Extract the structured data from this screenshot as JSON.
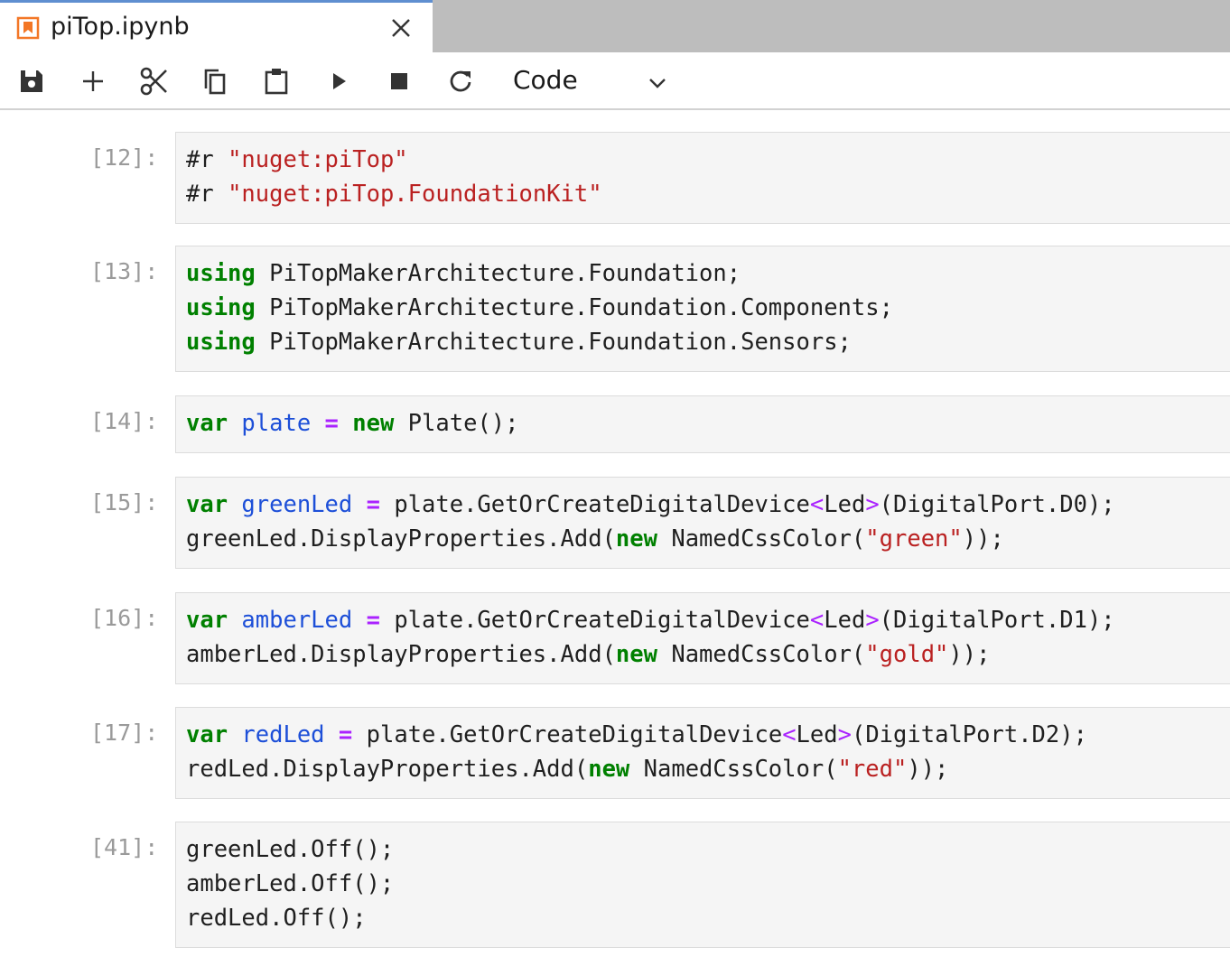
{
  "tab": {
    "title": "piTop.ipynb",
    "icon": "notebook-icon",
    "accent": "#f37726"
  },
  "toolbar": {
    "buttons": [
      "save-icon",
      "add-cell-icon",
      "cut-icon",
      "copy-icon",
      "paste-icon",
      "run-icon",
      "stop-icon",
      "restart-icon"
    ],
    "cell_type": "Code"
  },
  "cells": [
    {
      "prompt": "[12]:",
      "lines": [
        [
          [
            "#r ",
            ""
          ],
          [
            "\"nuget:piTop\"",
            "str"
          ]
        ],
        [
          [
            "#r ",
            ""
          ],
          [
            "\"nuget:piTop.FoundationKit\"",
            "str"
          ]
        ]
      ]
    },
    {
      "prompt": "[13]:",
      "lines": [
        [
          [
            "using",
            "kw"
          ],
          [
            " PiTopMakerArchitecture.Foundation;",
            ""
          ]
        ],
        [
          [
            "using",
            "kw"
          ],
          [
            " PiTopMakerArchitecture.Foundation.Components;",
            ""
          ]
        ],
        [
          [
            "using",
            "kw"
          ],
          [
            " PiTopMakerArchitecture.Foundation.Sensors;",
            ""
          ]
        ]
      ]
    },
    {
      "prompt": "[14]:",
      "lines": [
        [
          [
            "var",
            "kw"
          ],
          [
            " ",
            ""
          ],
          [
            "plate",
            "var"
          ],
          [
            " ",
            ""
          ],
          [
            "=",
            "op"
          ],
          [
            " ",
            ""
          ],
          [
            "new",
            "kw"
          ],
          [
            " Plate();",
            ""
          ]
        ]
      ]
    },
    {
      "prompt": "[15]:",
      "lines": [
        [
          [
            "var",
            "kw"
          ],
          [
            " ",
            ""
          ],
          [
            "greenLed",
            "var"
          ],
          [
            " ",
            ""
          ],
          [
            "=",
            "op"
          ],
          [
            " plate.GetOrCreateDigitalDevice",
            ""
          ],
          [
            "<",
            "ang"
          ],
          [
            "Led",
            ""
          ],
          [
            ">",
            "ang"
          ],
          [
            "(DigitalPort.D0);",
            ""
          ]
        ],
        [
          [
            "greenLed.DisplayProperties.Add(",
            ""
          ],
          [
            "new",
            "kw"
          ],
          [
            " NamedCssColor(",
            ""
          ],
          [
            "\"green\"",
            "str"
          ],
          [
            "));",
            ""
          ]
        ]
      ]
    },
    {
      "prompt": "[16]:",
      "lines": [
        [
          [
            "var",
            "kw"
          ],
          [
            " ",
            ""
          ],
          [
            "amberLed",
            "var"
          ],
          [
            " ",
            ""
          ],
          [
            "=",
            "op"
          ],
          [
            " plate.GetOrCreateDigitalDevice",
            ""
          ],
          [
            "<",
            "ang"
          ],
          [
            "Led",
            ""
          ],
          [
            ">",
            "ang"
          ],
          [
            "(DigitalPort.D1);",
            ""
          ]
        ],
        [
          [
            "amberLed.DisplayProperties.Add(",
            ""
          ],
          [
            "new",
            "kw"
          ],
          [
            " NamedCssColor(",
            ""
          ],
          [
            "\"gold\"",
            "str"
          ],
          [
            "));",
            ""
          ]
        ]
      ]
    },
    {
      "prompt": "[17]:",
      "lines": [
        [
          [
            "var",
            "kw"
          ],
          [
            " ",
            ""
          ],
          [
            "redLed",
            "var"
          ],
          [
            " ",
            ""
          ],
          [
            "=",
            "op"
          ],
          [
            " plate.GetOrCreateDigitalDevice",
            ""
          ],
          [
            "<",
            "ang"
          ],
          [
            "Led",
            ""
          ],
          [
            ">",
            "ang"
          ],
          [
            "(DigitalPort.D2);",
            ""
          ]
        ],
        [
          [
            "redLed.DisplayProperties.Add(",
            ""
          ],
          [
            "new",
            "kw"
          ],
          [
            " NamedCssColor(",
            ""
          ],
          [
            "\"red\"",
            "str"
          ],
          [
            "));",
            ""
          ]
        ]
      ]
    },
    {
      "prompt": "[41]:",
      "lines": [
        [
          [
            "greenLed.Off();",
            ""
          ]
        ],
        [
          [
            "amberLed.Off();",
            ""
          ]
        ],
        [
          [
            "redLed.Off();",
            ""
          ]
        ]
      ]
    }
  ]
}
